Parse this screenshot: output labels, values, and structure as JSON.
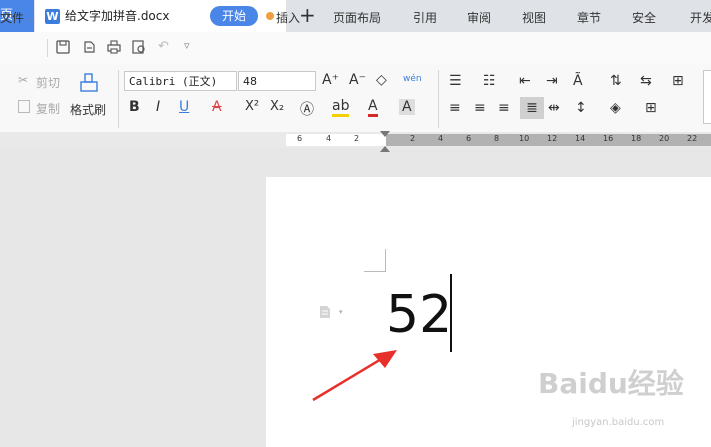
{
  "tabs": {
    "home_label": "页",
    "doc_title": "给文字加拼音.docx",
    "doc_icon_letter": "W",
    "new_tab": "+"
  },
  "menu": {
    "file": "文件",
    "start": "开始",
    "items": [
      "插入",
      "页面布局",
      "引用",
      "审阅",
      "视图",
      "章节",
      "安全",
      "开发"
    ]
  },
  "ribbon": {
    "cut": "剪切",
    "copy": "复制",
    "format_painter": "格式刷",
    "font_name": "Calibri (正文)",
    "font_size": "48",
    "bold": "B",
    "italic": "I",
    "underline": "U",
    "strike": "A",
    "superscript": "X²",
    "subscript": "X₂",
    "grow_font": "A⁺",
    "shrink_font": "A⁻",
    "pinyin": "wén",
    "font_color_letter": "A",
    "highlight_letter": "ab"
  },
  "ruler": {
    "ticks": [
      "6",
      "4",
      "2",
      "2",
      "4",
      "6",
      "8",
      "10",
      "12",
      "14",
      "16",
      "18",
      "20",
      "22"
    ]
  },
  "document": {
    "text": "52"
  },
  "watermark": {
    "main": "Baidu经验",
    "sub": "jingyan.baidu.com"
  },
  "colors": {
    "accent": "#4a86e8",
    "arrow": "#e8302a",
    "tab_dot": "#f0a040"
  }
}
